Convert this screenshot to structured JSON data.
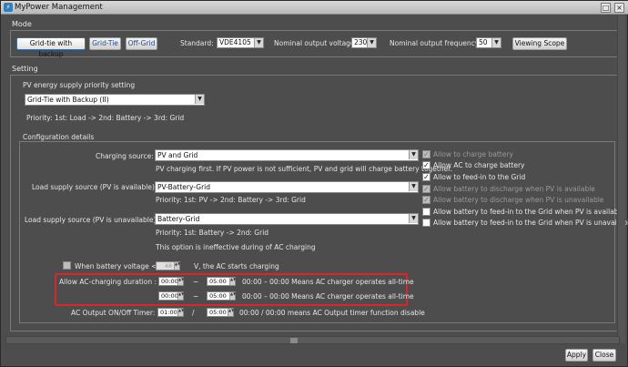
{
  "window": {
    "title": "MyPower Management"
  },
  "mode": {
    "section_label": "Mode",
    "buttons": [
      "Grid-tie with backup",
      "Grid-Tie",
      "Off-Grid"
    ],
    "standard_label": "Standard:",
    "standard_value": "VDE4105",
    "voltage_label": "Nominal output voltage:",
    "voltage_value": "230",
    "frequency_label": "Nominal output frequency:",
    "frequency_value": "50",
    "viewing_scope": "Viewing Scope"
  },
  "setting": {
    "section_label": "Setting",
    "pv_priority_label": "PV energy supply priority setting",
    "pv_priority_value": "Grid-Tie with Backup (II)",
    "priority_text": "Priority: 1st: Load -> 2nd: Battery -> 3rd: Grid"
  },
  "config": {
    "section_label": "Configuration details",
    "charging_source_label": "Charging source:",
    "charging_source_value": "PV and Grid",
    "charging_note": "PV charging first. If PV power is not sufficient, PV and grid will charge battery together.",
    "load_pv_available_label": "Load supply source (PV is available):",
    "load_pv_available_value": "PV-Battery-Grid",
    "load_pv_available_priority": "Priority: 1st: PV -> 2nd: Battery -> 3rd: Grid",
    "load_pv_unavailable_label": "Load supply source (PV is unavailable):",
    "load_pv_unavailable_value": "Battery-Grid",
    "load_pv_unavailable_priority": "Priority: 1st: Battery -> 2nd: Grid",
    "ineffective_note": "This option is ineffective during of AC charging",
    "checkboxes": [
      {
        "label": "Allow to charge battery",
        "checked": true,
        "disabled": true
      },
      {
        "label": "Allow AC to charge battery",
        "checked": true,
        "disabled": false
      },
      {
        "label": "Allow to feed-in to the Grid",
        "checked": true,
        "disabled": false
      },
      {
        "label": "Allow battery to discharge when PV is available",
        "checked": true,
        "disabled": true
      },
      {
        "label": "Allow battery to discharge when PV is unavailable",
        "checked": true,
        "disabled": true
      },
      {
        "label": "Allow battery to feed-in to the Grid when PV is available",
        "checked": false,
        "disabled": false
      },
      {
        "label": "Allow battery to feed-in to the Grid when PV is unavailable",
        "checked": false,
        "disabled": false
      }
    ],
    "battery_voltage_label": "When battery voltage <",
    "battery_voltage_value": "48",
    "battery_voltage_suffix": "V,  the AC starts charging",
    "ac_charging_label": "Allow AC-charging duration :",
    "ac_rows": [
      {
        "start": "00:00",
        "end": "05:00",
        "note": "00:00 – 00:00 Means AC charger operates all-time"
      },
      {
        "start": "00:00",
        "end": "05:00",
        "note": "00:00 – 00:00 Means AC charger operates all-time"
      }
    ],
    "tilde": "~",
    "timer_label": "AC Output ON/Off Timer:",
    "timer_start": "01:00",
    "timer_slash": "/",
    "timer_end": "05:00",
    "timer_note": "00:00 / 00:00 means AC Output timer function disable"
  },
  "footer": {
    "apply": "Apply",
    "close": "Close"
  },
  "accent_red": "#d8262b"
}
